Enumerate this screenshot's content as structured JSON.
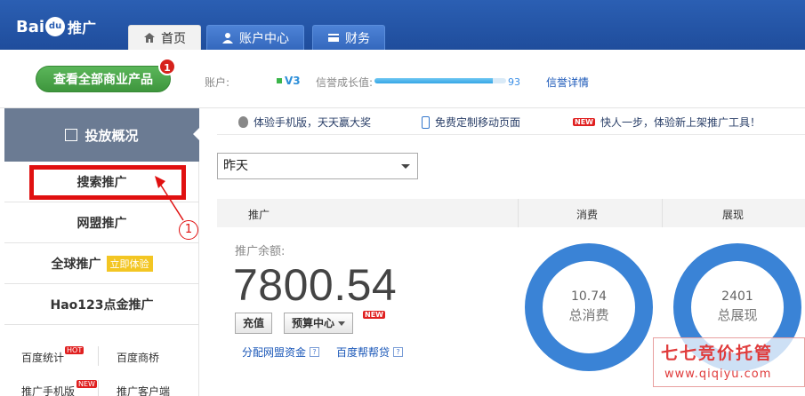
{
  "topnav": {
    "logo": {
      "text_a": "Bai",
      "paw": "du",
      "text_b": "推广"
    },
    "tabs": [
      {
        "label": "首页",
        "icon": "home-icon",
        "active": true
      },
      {
        "label": "账户中心",
        "icon": "user-icon",
        "active": false
      },
      {
        "label": "财务",
        "icon": "card-icon",
        "active": false
      }
    ]
  },
  "subheader": {
    "main_button": "查看全部商业产品",
    "main_button_badge": "1",
    "account_label": "账户:",
    "level": "V3",
    "credit_label": "信誉成长值:",
    "credit_value": "93",
    "credit_progress": 0.9,
    "credit_link": "信誉详情"
  },
  "notices": [
    {
      "icon": "apple-icon",
      "text": "体验手机版，天天赢大奖"
    },
    {
      "icon": "phone-icon",
      "text": "免费定制移动页面"
    },
    {
      "icon": "new-badge",
      "badge": "NEW",
      "text": "快人一步，体验新上架推广工具！"
    }
  ],
  "sidebar": {
    "header": "投放概况",
    "items": [
      {
        "label": "搜索推广"
      },
      {
        "label": "网盟推广"
      },
      {
        "label": "全球推广",
        "badge": "立即体验"
      },
      {
        "label": "Hao123点金推广"
      }
    ],
    "small_links": [
      {
        "label": "百度统计",
        "badge": "HOT"
      },
      {
        "label": "百度商桥"
      },
      {
        "label": "推广手机版",
        "badge": "NEW"
      },
      {
        "label": "推广客户端"
      }
    ]
  },
  "annotation": {
    "number": "1"
  },
  "date_select": {
    "value": "昨天"
  },
  "panel": {
    "columns": [
      "推广",
      "消费",
      "展现"
    ],
    "balance_label": "推广余额:",
    "balance_value": "7800.54",
    "buttons": {
      "recharge": "充值",
      "budget": "预算中心",
      "budget_badge": "NEW"
    },
    "links": [
      {
        "label": "分配网盟资金"
      },
      {
        "label": "百度帮帮贷"
      }
    ],
    "rings": [
      {
        "value": "10.74",
        "label": "总消费",
        "color": "#3a83d6"
      },
      {
        "value": "2401",
        "label": "总展现",
        "color": "#3a83d6"
      }
    ]
  },
  "watermark": {
    "title": "七七竞价托管",
    "url": "www.qiqiyu.com"
  },
  "colors": {
    "nav_blue": "#2b5fb3",
    "accent_green": "#4caf4b",
    "alert_red": "#e01010",
    "ring_blue": "#3a83d6"
  }
}
